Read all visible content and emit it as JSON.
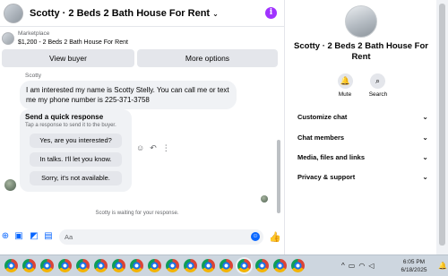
{
  "chat": {
    "title": "Scotty · 2 Beds 2 Bath House For Rent",
    "title_chevron": "⌄",
    "info_icon_glyph": "i",
    "marketplace_label": "Marketplace",
    "listing_text": "$1,200 - 2 Beds 2 Bath House For Rent",
    "view_buyer_label": "View buyer",
    "more_options_label": "More options",
    "sender_name": "Scotty",
    "incoming_message": "I am interested my name is Scotty Stelly. You can call me or text me my phone number is 225-371-3758",
    "quick_response": {
      "title": "Send a quick response",
      "subtitle": "Tap a response to send it to the buyer.",
      "options": [
        "Yes, are you interested?",
        "In talks. I'll let you know.",
        "Sorry, it's not available."
      ]
    },
    "waiting_text": "Scotty is waiting for your response.",
    "composer_placeholder": "Aa"
  },
  "info": {
    "name": "Scotty · 2 Beds 2 Bath House For Rent",
    "mute_label": "Mute",
    "search_label": "Search",
    "menu": [
      "Customize chat",
      "Chat members",
      "Media, files and links",
      "Privacy & support"
    ],
    "chevron": "⌄"
  },
  "taskbar": {
    "time": "6:05 PM",
    "date": "6/18/2025",
    "tray_chevron": "^"
  },
  "colors": {
    "accent": "#0866ff",
    "info_purple": "#a033ff",
    "bubble": "#f0f2f5",
    "button": "#e4e6eb"
  }
}
